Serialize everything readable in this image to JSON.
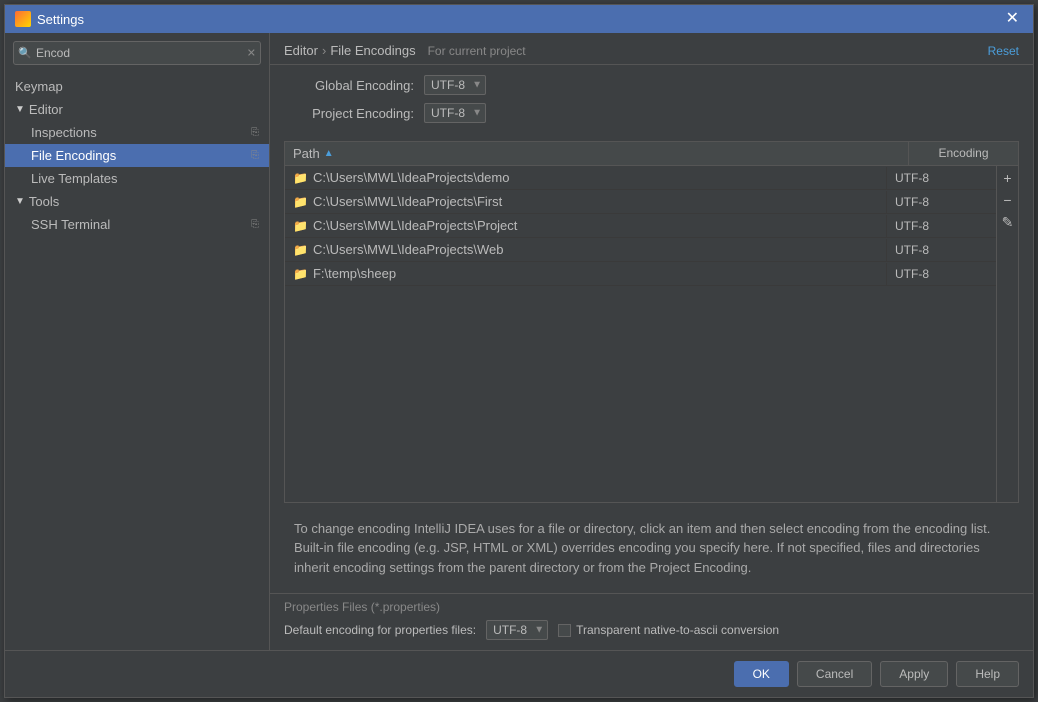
{
  "window": {
    "title": "Settings"
  },
  "search": {
    "value": "Encod",
    "placeholder": "Search..."
  },
  "sidebar": {
    "keymap_label": "Keymap",
    "editor_label": "Editor",
    "editor_expanded": true,
    "editor_children": [
      {
        "id": "inspections",
        "label": "Inspections",
        "selected": false
      },
      {
        "id": "file-encodings",
        "label": "File Encodings",
        "selected": true
      },
      {
        "id": "live-templates",
        "label": "Live Templates",
        "selected": false
      }
    ],
    "tools_label": "Tools",
    "tools_expanded": true,
    "tools_children": [
      {
        "id": "ssh-terminal",
        "label": "SSH Terminal",
        "selected": false
      }
    ]
  },
  "header": {
    "breadcrumb_parent": "Editor",
    "breadcrumb_sep": "›",
    "breadcrumb_current": "File Encodings",
    "for_project": "For current project",
    "reset_label": "Reset"
  },
  "encoding": {
    "global_label": "Global Encoding:",
    "global_value": "UTF-8",
    "project_label": "Project Encoding:",
    "project_value": "UTF-8"
  },
  "table": {
    "col_path": "Path",
    "col_encoding": "Encoding",
    "rows": [
      {
        "path": "C:\\Users\\MWL\\IdeaProjects\\demo",
        "encoding": "UTF-8"
      },
      {
        "path": "C:\\Users\\MWL\\IdeaProjects\\First",
        "encoding": "UTF-8"
      },
      {
        "path": "C:\\Users\\MWL\\IdeaProjects\\Project",
        "encoding": "UTF-8"
      },
      {
        "path": "C:\\Users\\MWL\\IdeaProjects\\Web",
        "encoding": "UTF-8"
      },
      {
        "path": "F:\\temp\\sheep",
        "encoding": "UTF-8"
      }
    ],
    "add_icon": "+",
    "remove_icon": "−",
    "edit_icon": "✎"
  },
  "info": {
    "text": "To change encoding IntelliJ IDEA uses for a file or directory, click an item and then select encoding from the encoding list. Built-in file encoding (e.g. JSP, HTML or XML) overrides encoding you specify here. If not specified, files and directories inherit encoding settings from the parent directory or from the Project Encoding."
  },
  "properties": {
    "section_label": "Properties Files (*.properties)",
    "default_encoding_label": "Default encoding for properties files:",
    "default_encoding_value": "UTF-8",
    "transparent_label": "Transparent native-to-ascii conversion",
    "transparent_checked": false
  },
  "footer": {
    "ok_label": "OK",
    "cancel_label": "Cancel",
    "apply_label": "Apply",
    "help_label": "Help"
  }
}
